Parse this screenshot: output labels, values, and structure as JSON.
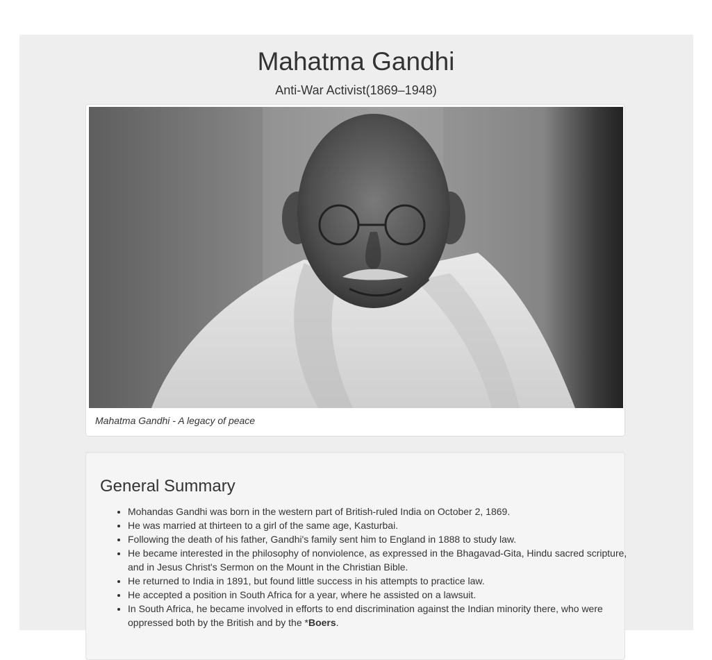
{
  "page": {
    "title": "Mahatma Gandhi",
    "subtitle": "Anti-War Activist(1869–1948)"
  },
  "portrait": {
    "caption": "Mahatma Gandhi - A legacy of peace"
  },
  "summary": {
    "heading": "General Summary",
    "items": [
      "Mohandas Gandhi was born in the western part of British-ruled India on October 2, 1869.",
      "He was married at thirteen to a girl of the same age, Kasturbai.",
      "Following the death of his father, Gandhi's family sent him to England in 1888 to study law.",
      "He became interested in the philosophy of nonviolence, as expressed in the Bhagavad-Gita, Hindu sacred scripture, and in Jesus Christ's Sermon on the Mount in the Christian Bible.",
      "He returned to India in 1891, but found little success in his attempts to practice law.",
      "He accepted a position in South Africa for a year, where he assisted on a lawsuit."
    ],
    "last_item_prefix": "In South Africa, he became involved in efforts to end discrimination against the Indian minority there, who were oppressed both by the British and by the *",
    "last_item_bold": "Boers",
    "last_item_suffix": "."
  }
}
